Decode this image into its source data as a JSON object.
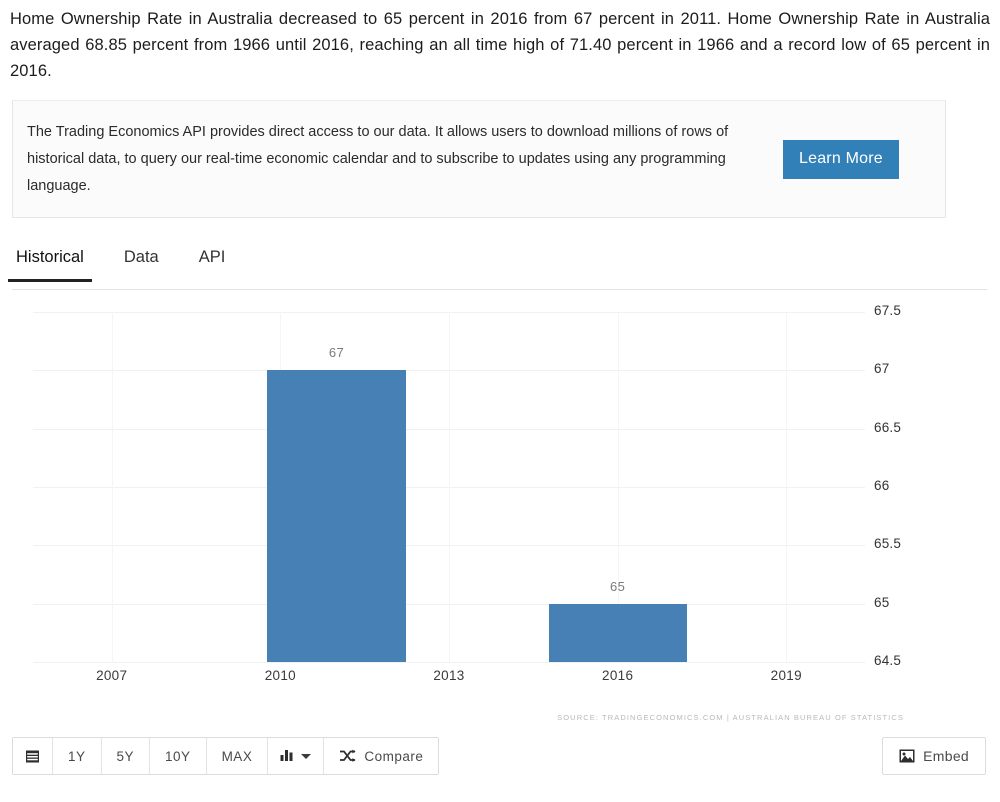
{
  "intro": {
    "paragraph": "Home Ownership Rate in Australia decreased to 65 percent in 2016 from 67 percent in 2011. Home Ownership Rate in Australia averaged 68.85 percent from 1966 until 2016, reaching an all time high of 71.40 percent in 1966 and a record low of 65 percent in 2016."
  },
  "api_banner": {
    "text": "The Trading Economics API provides direct access to our data. It allows users to download millions of rows of historical data, to query our real-time economic calendar and to subscribe to updates using any programming language.",
    "button_label": "Learn More",
    "button_color": "#3280b8"
  },
  "tabs": [
    {
      "label": "Historical",
      "active": true
    },
    {
      "label": "Data",
      "active": false
    },
    {
      "label": "API",
      "active": false
    }
  ],
  "chart_data": {
    "type": "bar",
    "title": "",
    "xlabel": "",
    "ylabel": "",
    "categories": [
      "2011",
      "2016"
    ],
    "values": [
      67,
      65
    ],
    "bar_labels": [
      "67",
      "65"
    ],
    "ylim": [
      64.5,
      67.5
    ],
    "yticks": [
      "67.5",
      "67",
      "66.5",
      "66",
      "65.5",
      "65",
      "64.5"
    ],
    "ytick_values": [
      67.5,
      67,
      66.5,
      66,
      65.5,
      65,
      64.5
    ],
    "xticks": [
      "2007",
      "2010",
      "2013",
      "2016",
      "2019"
    ],
    "xtick_values": [
      2007,
      2010,
      2013,
      2016,
      2019
    ],
    "xlim": [
      2005.6,
      2020.4
    ],
    "grid": true,
    "legend": "none",
    "bar_color": "#4680b4",
    "source": "SOURCE: TRADINGECONOMICS.COM | AUSTRALIAN BUREAU OF STATISTICS"
  },
  "toolbar": {
    "calendar_label": "",
    "ranges": [
      "1Y",
      "5Y",
      "10Y",
      "MAX"
    ],
    "charttype_label": "",
    "compare_label": "Compare",
    "embed_label": "Embed"
  }
}
